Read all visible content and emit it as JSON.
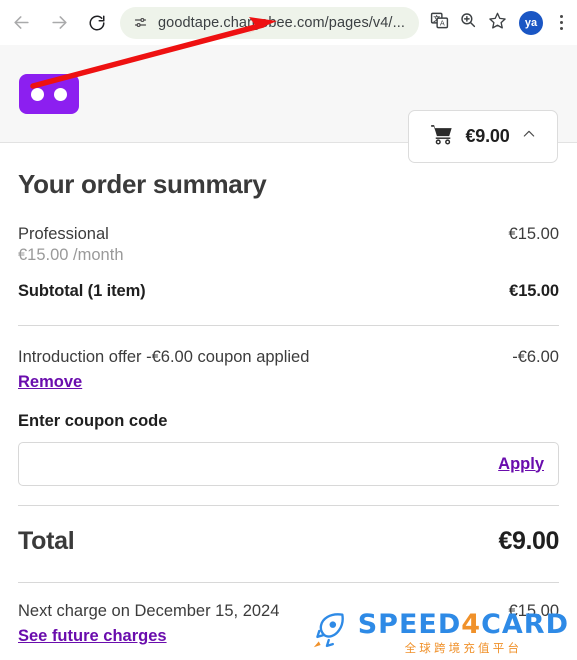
{
  "browser": {
    "back_icon": "back-arrow-icon",
    "forward_icon": "forward-arrow-icon",
    "reload_icon": "reload-icon",
    "site_controls_icon": "site-settings-icon",
    "url": "goodtape.chargebee.com/pages/v4/...",
    "translate_icon": "translate-icon",
    "zoom_icon": "zoom-search-icon",
    "bookmark_icon": "bookmark-star-icon",
    "avatar_label": "ya",
    "menu_icon": "kebab-menu-icon"
  },
  "header": {
    "logo_name": "goodtape-logo",
    "cart_icon": "shopping-cart-icon",
    "cart_amount": "€9.00",
    "chevron_icon": "chevron-up-icon"
  },
  "summary": {
    "title": "Your order summary",
    "plan": {
      "name": "Professional",
      "price": "€15.00",
      "recurrence": "€15.00 /month"
    },
    "subtotal": {
      "label": "Subtotal (1 item)",
      "value": "€15.00"
    },
    "coupon_applied": {
      "description": "Introduction offer -€6.00 coupon applied",
      "value": "-€6.00",
      "remove_label": "Remove"
    },
    "coupon_form": {
      "label": "Enter coupon code",
      "value": "",
      "placeholder": "",
      "apply_label": "Apply"
    },
    "total": {
      "label": "Total",
      "value": "€9.00"
    },
    "next_charge": {
      "text": "Next charge on December 15, 2024",
      "value": "€15.00",
      "link_label": "See future charges"
    }
  },
  "watermark": {
    "rocket_icon": "rocket-icon",
    "brand_1": "SPEED",
    "brand_2": "4",
    "brand_3": "CARD",
    "tagline": "全球跨境充值平台"
  },
  "colors": {
    "brand_purple": "#8c1ff0",
    "link_purple": "#6a0dad",
    "annotation_red": "#ee1111",
    "omnibox_bg": "#eef3ea",
    "header_bg": "#f7f7f7"
  }
}
